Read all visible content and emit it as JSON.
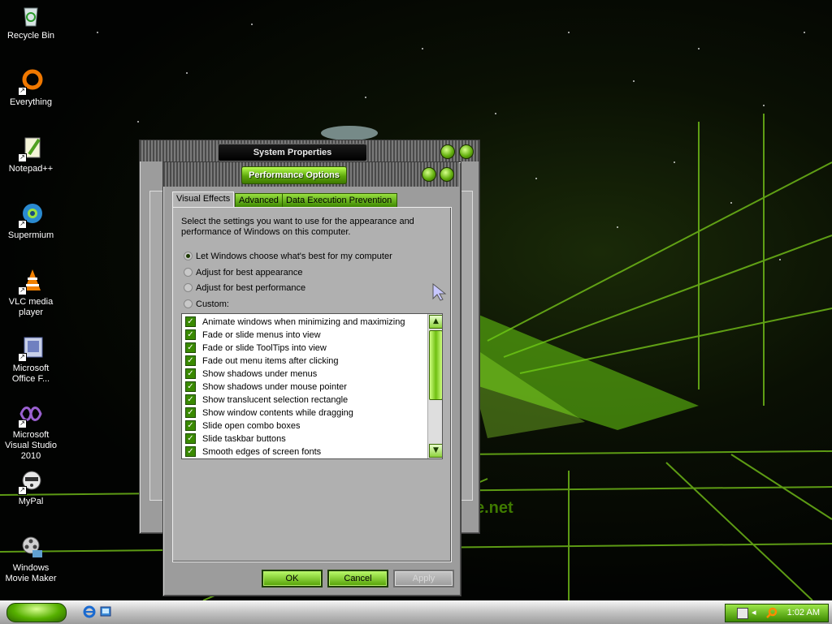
{
  "desktop": {
    "icons": [
      {
        "label": "Recycle Bin"
      },
      {
        "label": "Everything"
      },
      {
        "label": "Notepad++"
      },
      {
        "label": "Supermium"
      },
      {
        "label": "VLC media player"
      },
      {
        "label": "Microsoft Office F..."
      },
      {
        "label": "Microsoft Visual Studio 2010"
      },
      {
        "label": "MyPal"
      },
      {
        "label": "Windows Movie Maker"
      }
    ],
    "wallpaper_text": "e.net"
  },
  "system_properties": {
    "title": "System Properties"
  },
  "performance_options": {
    "title": "Performance Options",
    "tabs": [
      "Visual Effects",
      "Advanced",
      "Data Execution Prevention"
    ],
    "active_tab": "Visual Effects",
    "description": "Select the settings you want to use for the appearance and performance of Windows on this computer.",
    "radio_options": [
      {
        "label": "Let Windows choose what's best for my computer",
        "selected": true
      },
      {
        "label": "Adjust for best appearance",
        "selected": false
      },
      {
        "label": "Adjust for best performance",
        "selected": false
      },
      {
        "label": "Custom:",
        "selected": false
      }
    ],
    "effects": [
      {
        "label": "Animate windows when minimizing and maximizing",
        "checked": true
      },
      {
        "label": "Fade or slide menus into view",
        "checked": true
      },
      {
        "label": "Fade or slide ToolTips into view",
        "checked": true
      },
      {
        "label": "Fade out menu items after clicking",
        "checked": true
      },
      {
        "label": "Show shadows under menus",
        "checked": true
      },
      {
        "label": "Show shadows under mouse pointer",
        "checked": true
      },
      {
        "label": "Show translucent selection rectangle",
        "checked": true
      },
      {
        "label": "Show window contents while dragging",
        "checked": true
      },
      {
        "label": "Slide open combo boxes",
        "checked": true
      },
      {
        "label": "Slide taskbar buttons",
        "checked": true
      },
      {
        "label": "Smooth edges of screen fonts",
        "checked": true
      }
    ],
    "buttons": {
      "ok": "OK",
      "cancel": "Cancel",
      "apply": "Apply"
    }
  },
  "taskbar": {
    "clock": "1:02 AM"
  },
  "colors": {
    "accent_green": "#5ea80c",
    "window_gray": "#9c9c9c"
  }
}
